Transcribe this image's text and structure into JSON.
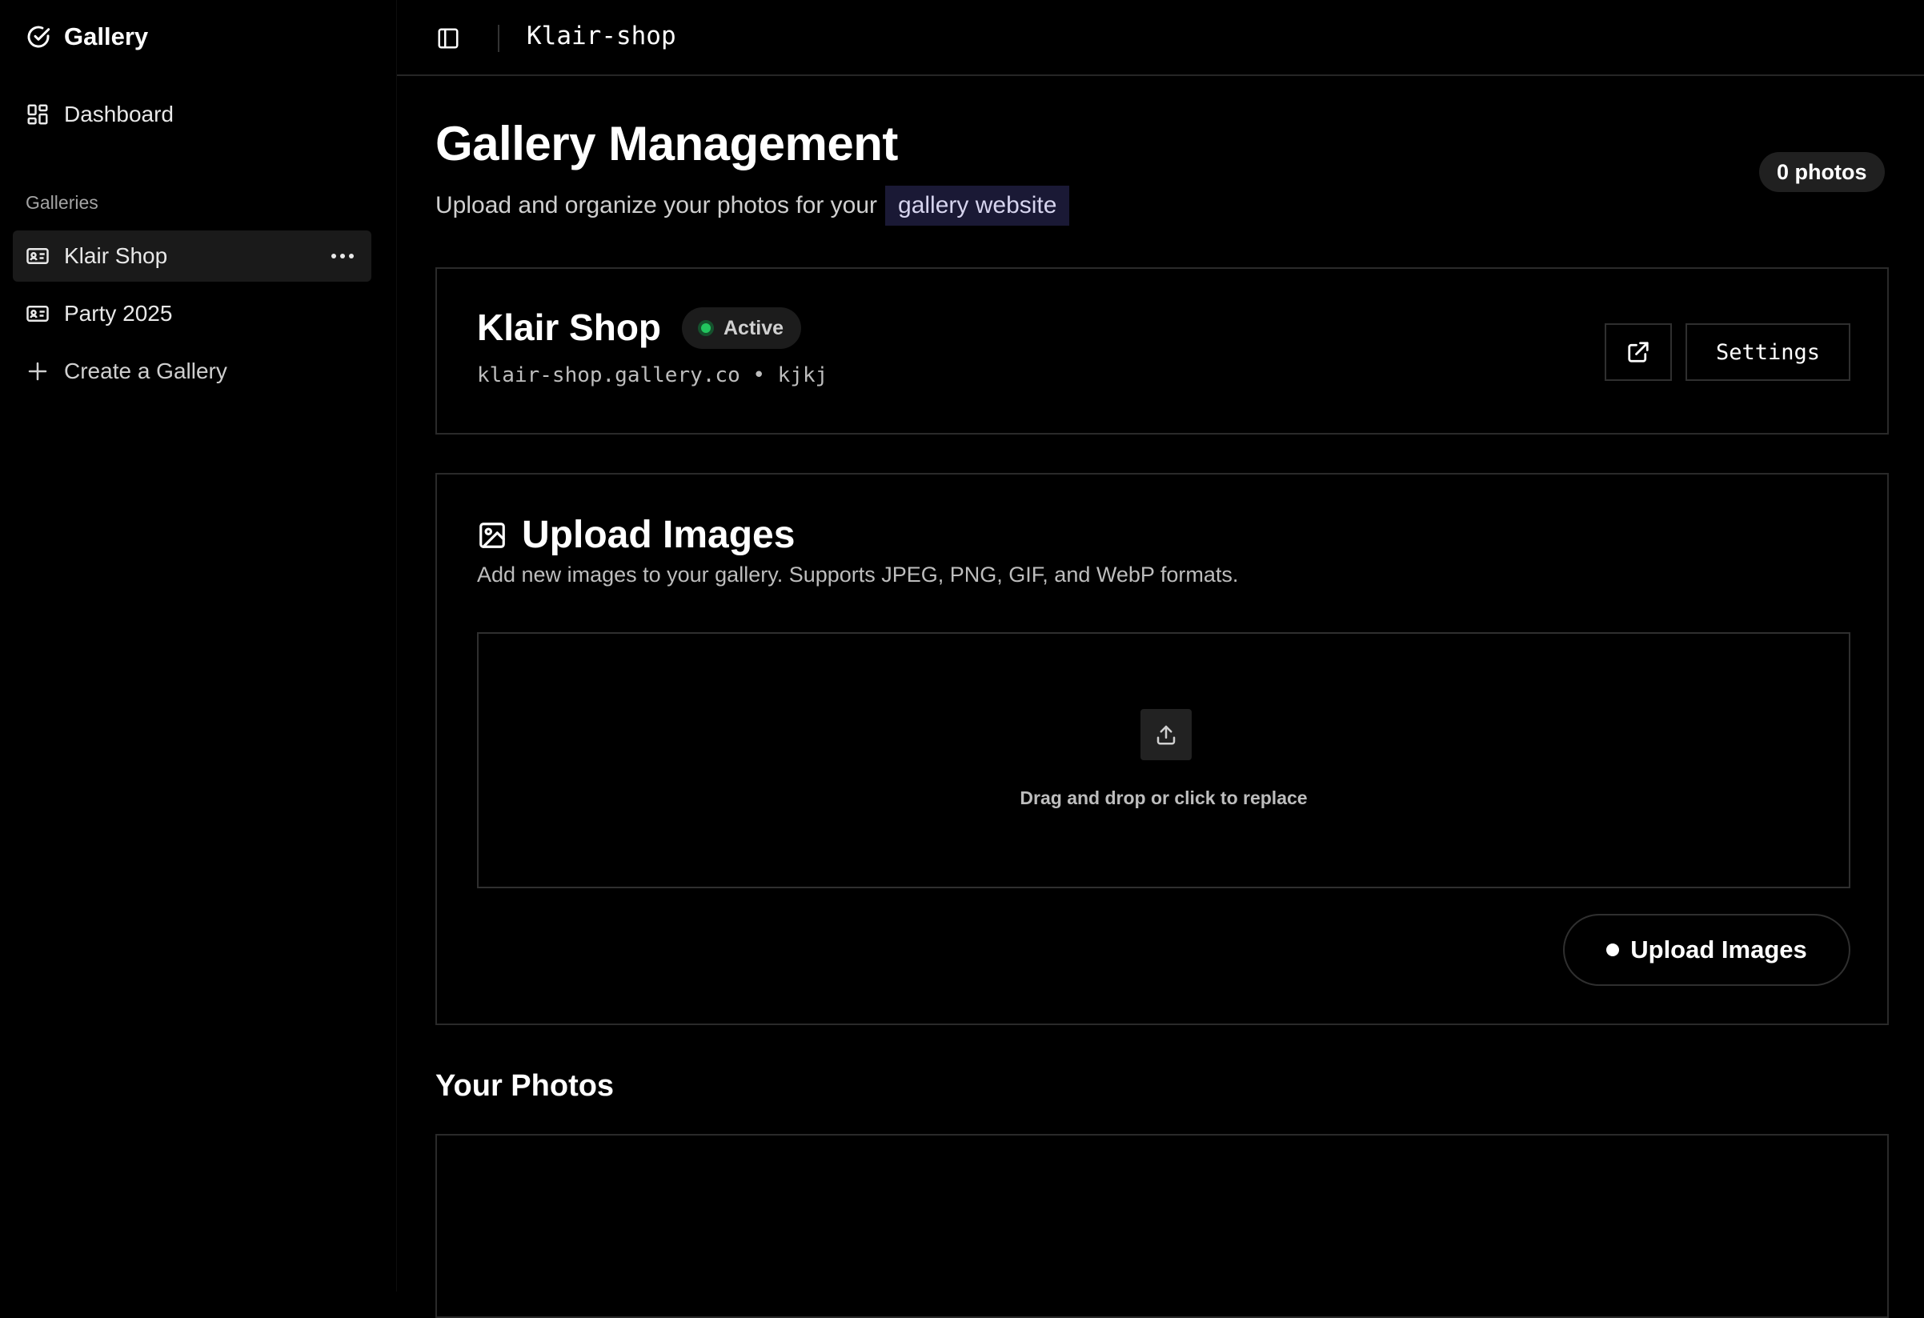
{
  "sidebar": {
    "brand": "Gallery",
    "dashboard_label": "Dashboard",
    "section_label": "Galleries",
    "galleries": [
      {
        "label": "Klair Shop"
      },
      {
        "label": "Party 2025"
      }
    ],
    "create_label": "Create a Gallery"
  },
  "topbar": {
    "breadcrumb": "Klair-shop"
  },
  "header": {
    "title": "Gallery Management",
    "subtitle": "Upload and organize your photos for your",
    "subtitle_highlight": "gallery website",
    "photo_count": "0 photos"
  },
  "gallery_card": {
    "name": "Klair Shop",
    "status": "Active",
    "meta": "klair-shop.gallery.co • kjkj",
    "settings_label": "Settings"
  },
  "upload": {
    "title": "Upload Images",
    "description": "Add new images to your gallery. Supports JPEG, PNG, GIF, and WebP formats.",
    "dropzone_text": "Drag and drop or click to replace",
    "button_label": "Upload Images"
  },
  "photos": {
    "title": "Your Photos"
  },
  "colors": {
    "background": "#000000",
    "active_status": "#22c55e",
    "highlight_bg": "#1a1935"
  }
}
